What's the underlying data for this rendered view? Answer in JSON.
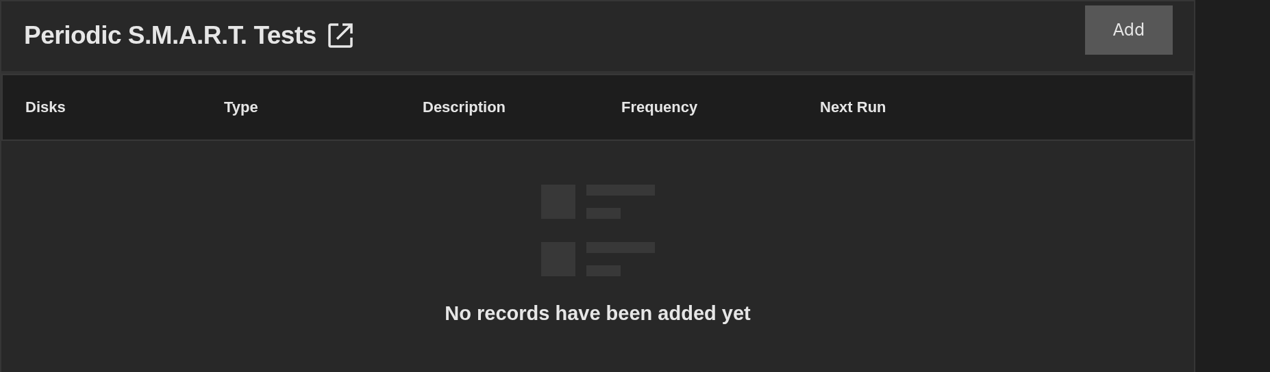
{
  "card": {
    "title": "Periodic S.M.A.R.T. Tests",
    "add_button": "Add"
  },
  "table": {
    "columns": [
      "Disks",
      "Type",
      "Description",
      "Frequency",
      "Next Run"
    ],
    "empty_message": "No records have been added yet"
  }
}
